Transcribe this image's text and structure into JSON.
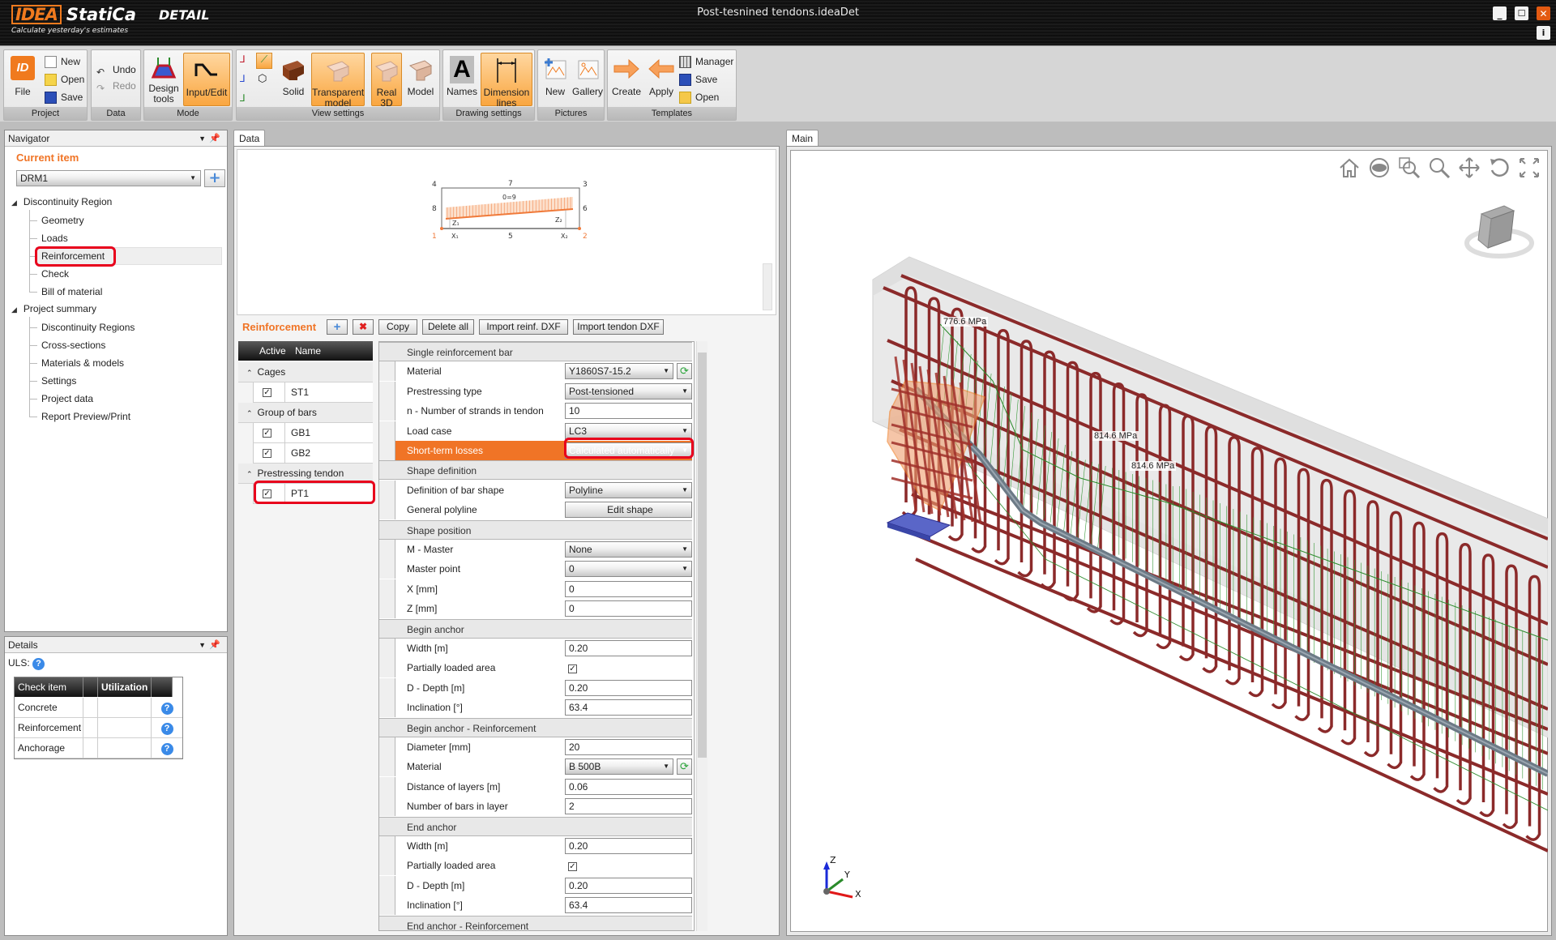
{
  "app": {
    "brand": "IDEA",
    "brand_name": "StatiCa",
    "product": "DETAIL",
    "tagline": "Calculate yesterday's estimates",
    "document_title": "Post-tesnined tendons.ideaDet",
    "window_buttons": [
      "minimize-icon",
      "maximize-icon",
      "close-icon",
      "info-icon"
    ]
  },
  "ribbon": {
    "groups": {
      "project": {
        "label": "Project",
        "file": "File",
        "new": "New",
        "open": "Open",
        "save": "Save"
      },
      "data": {
        "label": "Data",
        "undo": "Undo",
        "redo": "Redo"
      },
      "mode": {
        "label": "Mode",
        "design_tools": "Design tools",
        "input_edit": "Input/Edit"
      },
      "view": {
        "label": "View settings",
        "solid": "Solid",
        "transparent": "Transparent model",
        "real3d": "Real 3D",
        "model": "Model"
      },
      "drawing": {
        "label": "Drawing settings",
        "names": "Names",
        "dimension_lines": "Dimension lines"
      },
      "pictures": {
        "label": "Pictures",
        "new": "New",
        "gallery": "Gallery"
      },
      "templates": {
        "label": "Templates",
        "create": "Create",
        "apply": "Apply",
        "manager": "Manager",
        "save": "Save",
        "open": "Open"
      }
    }
  },
  "navigator": {
    "title": "Navigator",
    "current_item_label": "Current item",
    "current_item_value": "DRM1",
    "sections": [
      {
        "label": "Discontinuity Region",
        "items": [
          "Geometry",
          "Loads",
          "Reinforcement",
          "Check",
          "Bill of material"
        ]
      },
      {
        "label": "Project summary",
        "items": [
          "Discontinuity Regions",
          "Cross-sections",
          "Materials & models",
          "Settings",
          "Project data",
          "Report Preview/Print"
        ]
      }
    ],
    "selected": "Reinforcement"
  },
  "details": {
    "title": "Details",
    "uls_label": "ULS:",
    "columns": [
      "Check item",
      "",
      "Utilization",
      ""
    ],
    "rows": [
      {
        "item": "Concrete",
        "utilization": ""
      },
      {
        "item": "Reinforcement",
        "utilization": ""
      },
      {
        "item": "Anchorage",
        "utilization": ""
      }
    ]
  },
  "data_panel": {
    "tab": "Data",
    "diagram": {
      "points": [
        "1",
        "2",
        "3",
        "4",
        "5",
        "6",
        "7",
        "8"
      ],
      "label_center": "0=9",
      "labels": [
        "Z1",
        "Z2",
        "X1",
        "X2"
      ]
    },
    "reinforcement": {
      "title": "Reinforcement",
      "buttons": {
        "add": "add-icon",
        "delete": "delete-icon",
        "copy": "Copy",
        "delete_all": "Delete all",
        "import_reinf": "Import reinf. DXF",
        "import_tendon": "Import tendon DXF"
      },
      "grid_columns": [
        "Active",
        "Name"
      ],
      "groups": [
        {
          "label": "Cages",
          "items": [
            {
              "name": "ST1",
              "active": true
            }
          ]
        },
        {
          "label": "Group of bars",
          "items": [
            {
              "name": "GB1",
              "active": true
            },
            {
              "name": "GB2",
              "active": true
            }
          ]
        },
        {
          "label": "Prestressing tendon",
          "items": [
            {
              "name": "PT1",
              "active": true
            }
          ]
        }
      ]
    },
    "properties": [
      {
        "type": "section",
        "label": "Single reinforcement bar"
      },
      {
        "type": "dropdown",
        "label": "Material",
        "value": "Y1860S7-15.2",
        "refresh": true
      },
      {
        "type": "dropdown",
        "label": "Prestressing type",
        "value": "Post-tensioned"
      },
      {
        "type": "input",
        "label": "n - Number of strands in tendon",
        "value": "10"
      },
      {
        "type": "dropdown",
        "label": "Load case",
        "value": "LC3"
      },
      {
        "type": "dropdown",
        "label": "Short-term losses",
        "value": "Calculated automatically",
        "highlight": true
      },
      {
        "type": "section",
        "label": "Shape definition"
      },
      {
        "type": "dropdown",
        "label": "Definition of bar shape",
        "value": "Polyline"
      },
      {
        "type": "button",
        "label": "General polyline",
        "value": "Edit shape"
      },
      {
        "type": "section",
        "label": "Shape position"
      },
      {
        "type": "dropdown",
        "label": "M - Master",
        "value": "None"
      },
      {
        "type": "dropdown",
        "label": "Master point",
        "value": "0"
      },
      {
        "type": "input",
        "label": "X [mm]",
        "value": "0"
      },
      {
        "type": "input",
        "label": "Z [mm]",
        "value": "0"
      },
      {
        "type": "section",
        "label": "Begin anchor"
      },
      {
        "type": "input",
        "label": "Width [m]",
        "value": "0.20"
      },
      {
        "type": "checkbox",
        "label": "Partially loaded area",
        "value": true
      },
      {
        "type": "input",
        "label": "D - Depth [m]",
        "value": "0.20"
      },
      {
        "type": "input",
        "label": "Inclination [°]",
        "value": "63.4"
      },
      {
        "type": "section",
        "label": "Begin anchor - Reinforcement"
      },
      {
        "type": "input",
        "label": "Diameter [mm]",
        "value": "20"
      },
      {
        "type": "dropdown",
        "label": "Material",
        "value": "B 500B",
        "refresh": true
      },
      {
        "type": "input",
        "label": "Distance of layers [m]",
        "value": "0.06"
      },
      {
        "type": "input",
        "label": "Number of bars in layer",
        "value": "2"
      },
      {
        "type": "section",
        "label": "End anchor"
      },
      {
        "type": "input",
        "label": "Width [m]",
        "value": "0.20"
      },
      {
        "type": "checkbox",
        "label": "Partially loaded area",
        "value": true
      },
      {
        "type": "input",
        "label": "D - Depth [m]",
        "value": "0.20"
      },
      {
        "type": "input",
        "label": "Inclination [°]",
        "value": "63.4"
      },
      {
        "type": "section",
        "label": "End anchor - Reinforcement"
      }
    ]
  },
  "main_panel": {
    "tab": "Main",
    "toolbar": [
      "home-icon",
      "eye-icon",
      "zoom-window-icon",
      "zoom-icon",
      "pan-icon",
      "rotate-icon",
      "fullscreen-icon"
    ],
    "stress_labels": [
      "776.6 MPa",
      "814.6 MPa",
      "814.6 MPa"
    ],
    "axes": [
      "X",
      "Y",
      "Z"
    ]
  },
  "colors": {
    "accent": "#f07426",
    "highlight_box": "#e8001c",
    "rebar": "#8b2a2a",
    "tendon": "#6c7a86",
    "stress": "#2a8a2a"
  }
}
